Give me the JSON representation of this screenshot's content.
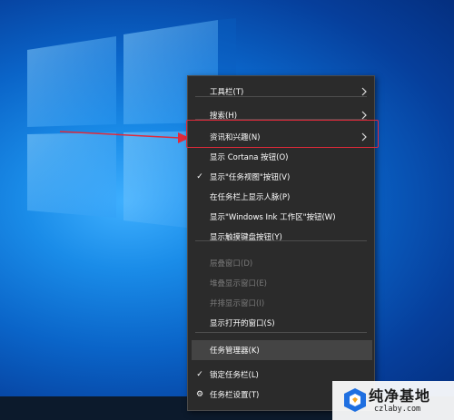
{
  "menu": {
    "items": [
      {
        "label": "工具栏(T)",
        "submenu": true,
        "checked": false,
        "disabled": false
      },
      {
        "label": "搜索(H)",
        "submenu": true,
        "checked": false,
        "disabled": false
      },
      {
        "label": "资讯和兴趣(N)",
        "submenu": true,
        "checked": false,
        "disabled": false
      },
      {
        "label": "显示 Cortana 按钮(O)",
        "submenu": false,
        "checked": false,
        "disabled": false
      },
      {
        "label": "显示\"任务视图\"按钮(V)",
        "submenu": false,
        "checked": true,
        "disabled": false
      },
      {
        "label": "在任务栏上显示人脉(P)",
        "submenu": false,
        "checked": false,
        "disabled": false
      },
      {
        "label": "显示\"Windows Ink 工作区\"按钮(W)",
        "submenu": false,
        "checked": false,
        "disabled": false
      },
      {
        "label": "显示触摸键盘按钮(Y)",
        "submenu": false,
        "checked": false,
        "disabled": false
      },
      {
        "label": "层叠窗口(D)",
        "submenu": false,
        "checked": false,
        "disabled": true
      },
      {
        "label": "堆叠显示窗口(E)",
        "submenu": false,
        "checked": false,
        "disabled": true
      },
      {
        "label": "并排显示窗口(I)",
        "submenu": false,
        "checked": false,
        "disabled": true
      },
      {
        "label": "显示打开的窗口(S)",
        "submenu": false,
        "checked": false,
        "disabled": false
      },
      {
        "label": "任务管理器(K)",
        "submenu": false,
        "checked": false,
        "disabled": false,
        "hovered": true
      },
      {
        "label": "锁定任务栏(L)",
        "submenu": false,
        "checked": true,
        "disabled": false
      },
      {
        "label": "任务栏设置(T)",
        "submenu": false,
        "checked": false,
        "disabled": false,
        "icon": "gear-icon"
      }
    ],
    "check_glyph": "✓",
    "gear_glyph": "⚙"
  },
  "annotation": {
    "color": "#e12a3a"
  },
  "watermark": {
    "title": "纯净基地",
    "url": "czlaby.com"
  }
}
